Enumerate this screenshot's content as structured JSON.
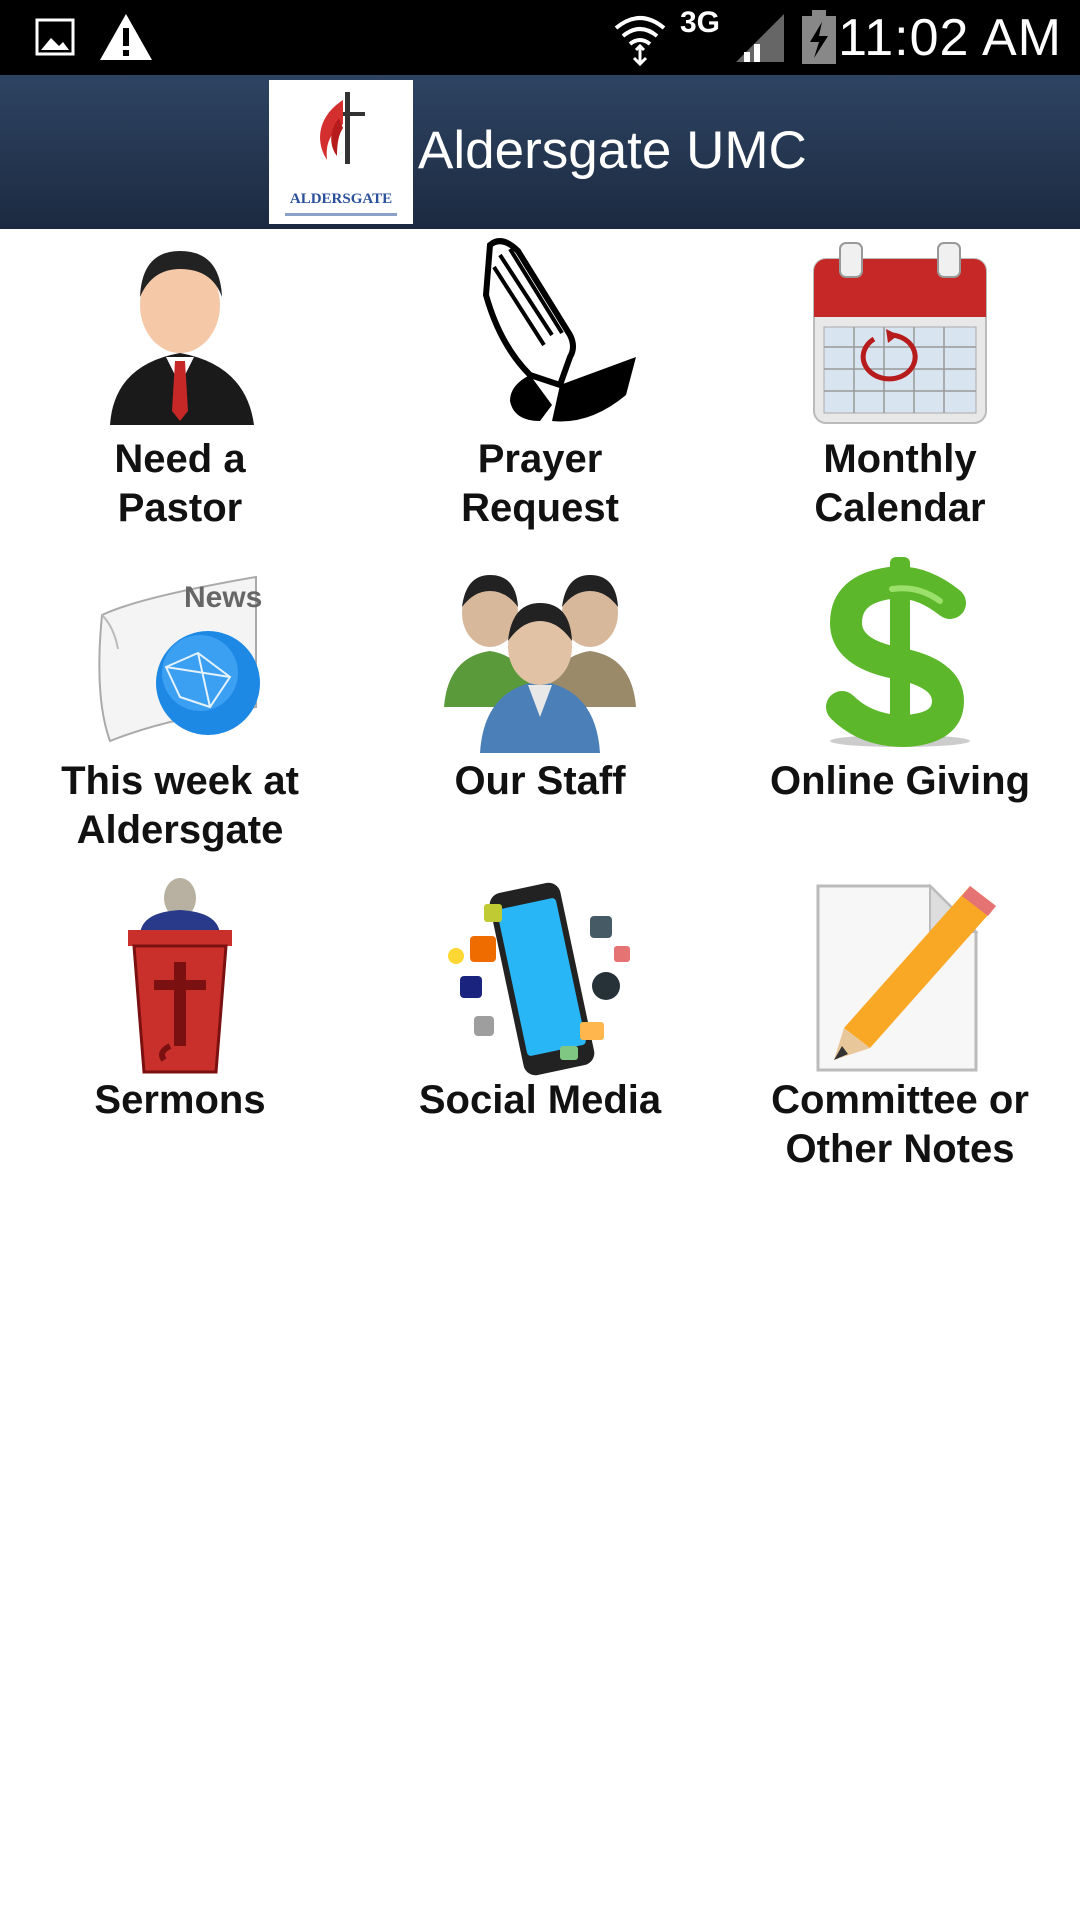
{
  "status_bar": {
    "time": "11:02 AM",
    "network": "3G",
    "icons": [
      "gallery-icon",
      "warning-icon",
      "wifi-icon",
      "signal-icon",
      "battery-icon"
    ]
  },
  "header": {
    "logo_caption": "ALDERSGATE",
    "title": "Aldersgate UMC"
  },
  "tiles": [
    {
      "label": "Need a\nPastor",
      "icon": "pastor-icon"
    },
    {
      "label": "Prayer\nRequest",
      "icon": "praying-hands-icon"
    },
    {
      "label": "Monthly\nCalendar",
      "icon": "calendar-icon"
    },
    {
      "label": "This week at\nAldersgate",
      "icon": "news-globe-icon"
    },
    {
      "label": "Our Staff",
      "icon": "staff-group-icon"
    },
    {
      "label": "Online Giving",
      "icon": "dollar-icon"
    },
    {
      "label": "Sermons",
      "icon": "pulpit-icon"
    },
    {
      "label": "Social Media",
      "icon": "smartphone-apps-icon"
    },
    {
      "label": "Committee or\nOther Notes",
      "icon": "notes-pencil-icon"
    }
  ],
  "colors": {
    "header_top": "#2e4463",
    "header_bottom": "#1c2a40",
    "calendar_red": "#c62828",
    "dollar_green": "#5cb82a",
    "pulpit_red": "#c9302c"
  }
}
